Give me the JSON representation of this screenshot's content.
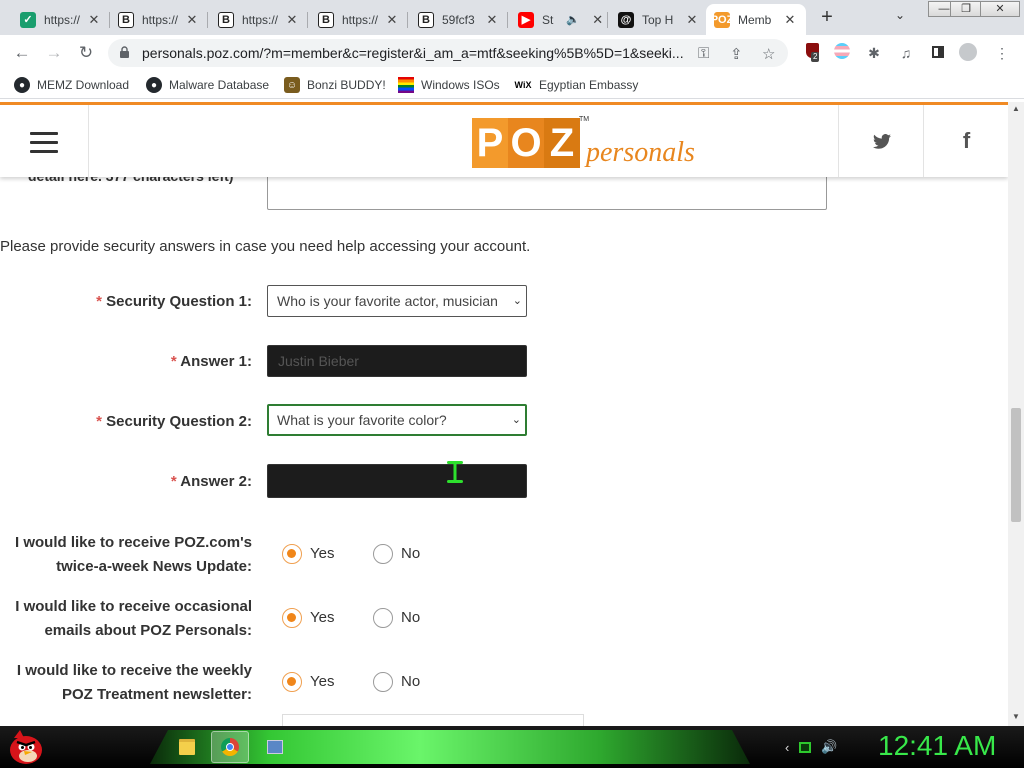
{
  "browser": {
    "tabs": [
      {
        "title": "https://",
        "icon": "green-app-icon"
      },
      {
        "title": "https://",
        "icon": "b-icon"
      },
      {
        "title": "https://",
        "icon": "b-icon"
      },
      {
        "title": "https://",
        "icon": "b-icon"
      },
      {
        "title": "59fcf3",
        "icon": "b-icon"
      },
      {
        "title": "St",
        "icon": "youtube-icon"
      },
      {
        "title": "Top H",
        "icon": "threads-icon"
      },
      {
        "title": "Memb",
        "icon": "poz-icon"
      }
    ],
    "active_tab_index": 7,
    "url": "personals.poz.com/?m=member&c=register&i_am_a=mtf&seeking%5B%5D=1&seeki...",
    "extension_badge": "2",
    "bookmarks": [
      {
        "label": "MEMZ Download",
        "icon": "github-icon"
      },
      {
        "label": "Malware Database",
        "icon": "github-icon"
      },
      {
        "label": "Bonzi BUDDY!",
        "icon": "bonzi-icon"
      },
      {
        "label": "Windows ISOs",
        "icon": "rainbow-icon"
      },
      {
        "label": "Egyptian Embassy",
        "icon": "wix-icon"
      }
    ]
  },
  "site": {
    "logo_text": "POZ",
    "logo_tagline": "personals",
    "logo_tm": "TM"
  },
  "form": {
    "partial_label": "detail here. 377 characters left)",
    "security_intro": "Please provide security answers in case you need help accessing your account.",
    "required_mark": "*",
    "security_question_1": {
      "label": "Security Question 1:",
      "value": "Who is your favorite actor, musician"
    },
    "answer_1": {
      "label": "Answer 1:",
      "value": "Justin Bieber"
    },
    "security_question_2": {
      "label": "Security Question 2:",
      "value": "What is your favorite color?"
    },
    "answer_2": {
      "label": "Answer 2:",
      "value": ""
    },
    "preferences": [
      {
        "label": "I would like to receive POZ.com's twice-a-week News Update:",
        "yes": "Yes",
        "no": "No",
        "selected": "Yes"
      },
      {
        "label": "I would like to receive occasional emails about POZ Personals:",
        "yes": "Yes",
        "no": "No",
        "selected": "Yes"
      },
      {
        "label": "I would like to receive the weekly POZ Treatment newsletter:",
        "yes": "Yes",
        "no": "No",
        "selected": "Yes"
      }
    ]
  },
  "taskbar": {
    "clock": "12:41 AM"
  },
  "colors": {
    "accent_orange": "#f08a24",
    "required_red": "#d9534f",
    "focus_green": "#2e7d32",
    "clock_green": "#38e84a"
  }
}
